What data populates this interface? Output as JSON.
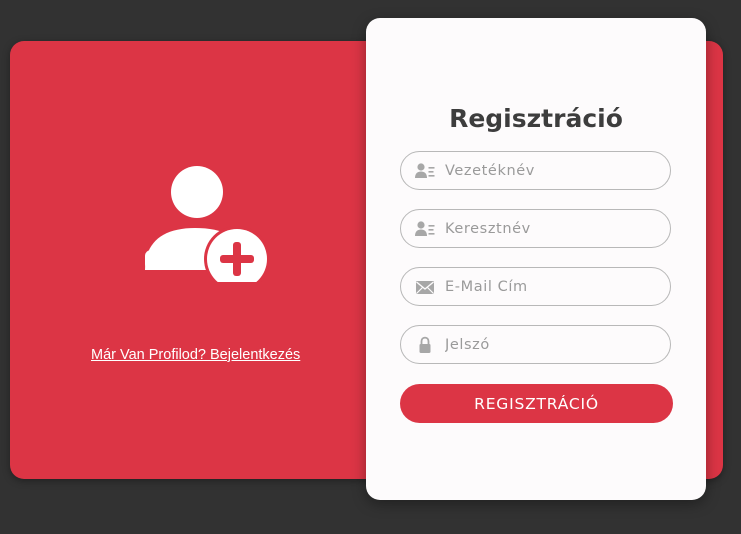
{
  "colors": {
    "background": "#323232",
    "accent": "#dc3545",
    "card": "#fdfbfc",
    "title_text": "#3d3d3d",
    "icon_gray": "#a7a7a7"
  },
  "left_panel": {
    "icon": "user-plus-icon",
    "login_link": "Már Van Profilod? Bejelentkezés"
  },
  "form": {
    "title": "Regisztráció",
    "fields": [
      {
        "icon": "id-card-icon",
        "placeholder": "Vezetéknév",
        "value": ""
      },
      {
        "icon": "id-card-icon",
        "placeholder": "Keresztnév",
        "value": ""
      },
      {
        "icon": "envelope-icon",
        "placeholder": "E-Mail Cím",
        "value": ""
      },
      {
        "icon": "lock-icon",
        "placeholder": "Jelszó",
        "value": ""
      }
    ],
    "submit_label": "REGISZTRÁCIÓ"
  }
}
